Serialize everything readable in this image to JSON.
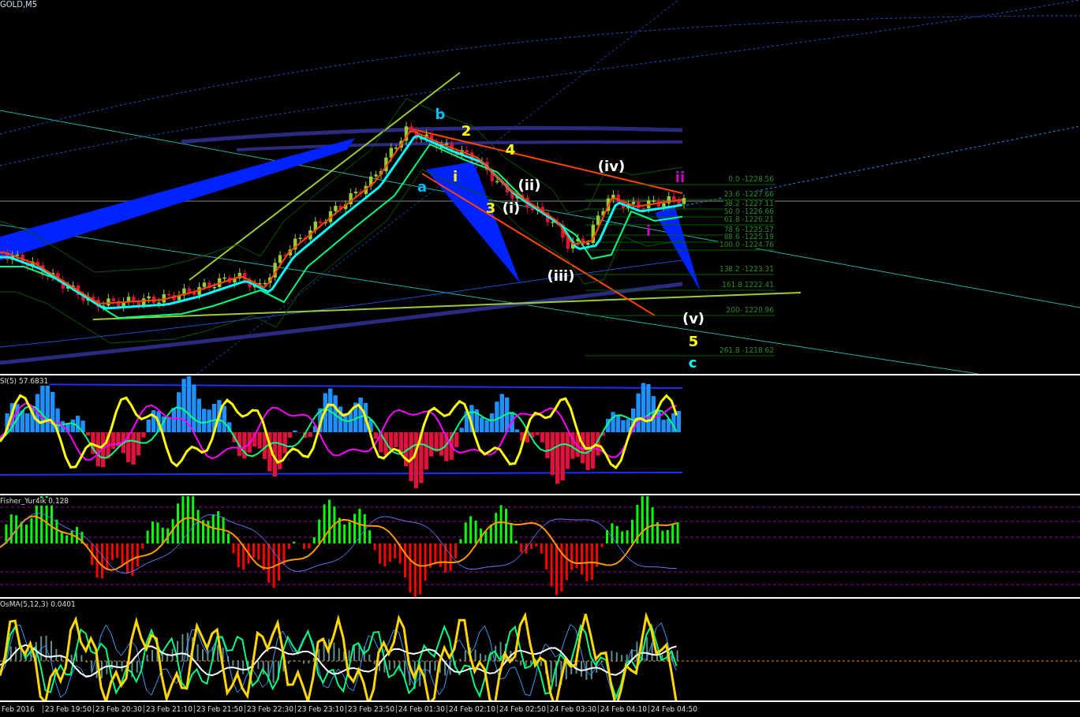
{
  "symbol_label": "GOLD,M5",
  "wave_labels": [
    {
      "text": "b",
      "color": "#00bfff"
    },
    {
      "text": "2",
      "color": "#ffff00"
    },
    {
      "text": "4",
      "color": "#ffff00"
    },
    {
      "text": "a",
      "color": "#00bfff"
    },
    {
      "text": "i",
      "color": "#ffff00"
    },
    {
      "text": "3",
      "color": "#ffff00"
    },
    {
      "text": "(i)",
      "color": "#ffffff"
    },
    {
      "text": "(ii)",
      "color": "#ffffff"
    },
    {
      "text": "(iii)",
      "color": "#ffffff"
    },
    {
      "text": "(iv)",
      "color": "#ffffff"
    },
    {
      "text": "ii",
      "color": "#cc00cc"
    },
    {
      "text": "i",
      "color": "#cc00cc"
    },
    {
      "text": "(v)",
      "color": "#ffffff"
    },
    {
      "text": "5",
      "color": "#ffff00"
    },
    {
      "text": "c",
      "color": "#00ffff"
    }
  ],
  "fib_levels": [
    {
      "label": "0.0 -1228.56"
    },
    {
      "label": "23.6 -1227.66"
    },
    {
      "label": "38.2 -1227.11"
    },
    {
      "label": "50.0 -1226.66"
    },
    {
      "label": "61.8 -1226.21"
    },
    {
      "label": "78.6 -1225.57"
    },
    {
      "label": "88.6 -1225.19"
    },
    {
      "label": "100.0 -1224.76"
    },
    {
      "label": "138.2  -1223.31"
    },
    {
      "label": "161.8 1222.41"
    },
    {
      "label": "200- 1220.96"
    },
    {
      "label": "261.8 -1218.62"
    }
  ],
  "indicators": [
    {
      "kind": "rsi",
      "title": "SI(5) 57.6831"
    },
    {
      "kind": "fisher",
      "title": "Fisher_Yur4ik 0.128"
    },
    {
      "kind": "osma",
      "title": "OsMA(5,12,3) 0.0401"
    }
  ],
  "time_axis": [
    "Feb 2016",
    "23 Feb 19:50",
    "23 Feb 20:30",
    "23 Feb 21:10",
    "23 Feb 21:50",
    "23 Feb 22:30",
    "23 Feb 23:10",
    "23 Feb 23:50",
    "24 Feb 01:30",
    "24 Feb 02:10",
    "24 Feb 02:50",
    "24 Feb 03:30",
    "24 Feb 04:10",
    "24 Feb 04:50"
  ]
}
